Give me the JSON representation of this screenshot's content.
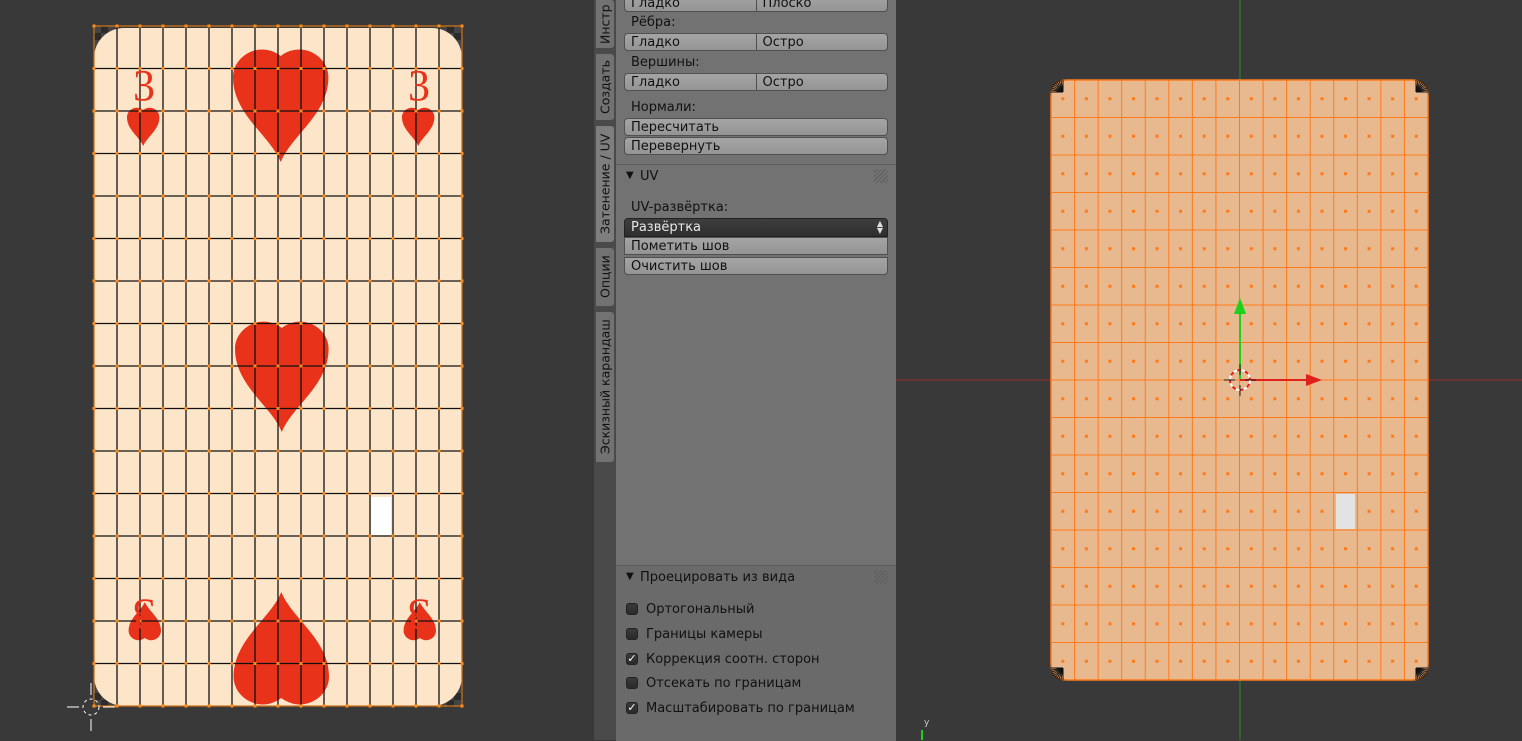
{
  "uv_editor": {
    "card_rank_top": "3",
    "card_rank_bottom": "3",
    "colors": {
      "card_fill": "#fde5c9",
      "suit": "#e8321a",
      "grid": "#111111",
      "selection": "#ff8c1a"
    }
  },
  "tool_shelf": {
    "tabs": [
      "Инстр",
      "Создать",
      "Затенение / UV",
      "Опции",
      "Эскизный карандаш"
    ],
    "shading": {
      "faces_buttons": [
        "Гладко",
        "Плоско"
      ],
      "edges_label": "Рёбра:",
      "edges_buttons": [
        "Гладко",
        "Остро"
      ],
      "vertices_label": "Вершины:",
      "vertices_buttons": [
        "Гладко",
        "Остро"
      ],
      "normals_label": "Нормали:",
      "recalculate": "Пересчитать",
      "flip": "Перевернуть"
    },
    "uv_panel": {
      "title": "UV",
      "unwrap_label": "UV-развёртка:",
      "unwrap_value": "Развёртка",
      "mark_seam": "Пометить шов",
      "clear_seam": "Очистить шов"
    },
    "project_panel": {
      "title": "Проецировать из вида",
      "options": [
        {
          "label": "Ортогональный",
          "checked": false
        },
        {
          "label": "Границы камеры",
          "checked": false
        },
        {
          "label": "Коррекция соотн. сторон",
          "checked": true
        },
        {
          "label": "Отсекать по границам",
          "checked": false
        },
        {
          "label": "Масштабировать по границам",
          "checked": true
        }
      ]
    }
  },
  "viewport": {
    "axis_label": "y",
    "colors": {
      "mesh_fill": "#e8b98f",
      "edges": "#ff7a1a",
      "x_axis": "#c02020",
      "y_axis": "#20c020"
    }
  }
}
